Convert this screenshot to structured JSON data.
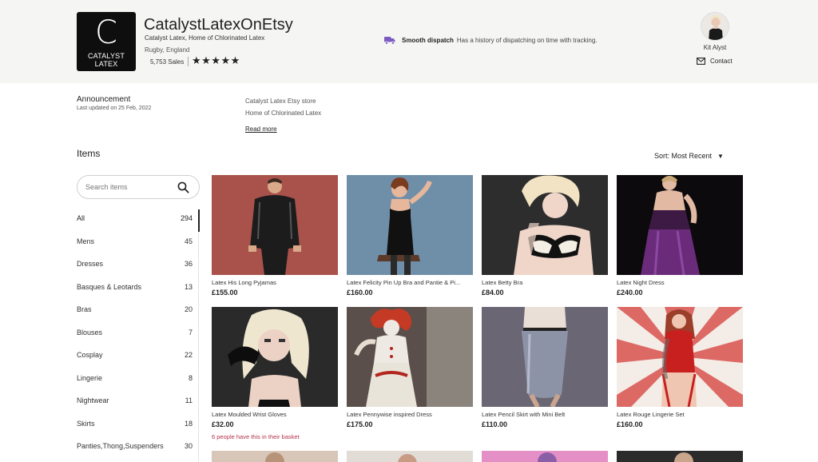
{
  "shop": {
    "logo_letter": "C",
    "logo_text": "CATALYST LATEX",
    "name": "CatalystLatexOnEtsy",
    "tagline": "Catalyst Latex, Home of Chlorinated Latex",
    "location": "Rugby, England",
    "sales": "5,753 Sales",
    "stars": "★★★★★",
    "rating": 5
  },
  "dispatch": {
    "title": "Smooth dispatch",
    "description": "Has a history of dispatching on time with tracking."
  },
  "owner": {
    "name": "Kit Alyst",
    "contact_label": "Contact"
  },
  "announcement": {
    "title": "Announcement",
    "updated": "Last updated on 25 Feb, 2022",
    "line1": "Catalyst Latex Etsy store",
    "line2": "Home of Chlorinated Latex",
    "read_more": "Read more"
  },
  "items": {
    "title": "Items",
    "sort_label": "Sort: Most Recent",
    "search_placeholder": "Search items"
  },
  "sections": [
    {
      "label": "All",
      "count": "294",
      "active": true
    },
    {
      "label": "Mens",
      "count": "45"
    },
    {
      "label": "Dresses",
      "count": "36"
    },
    {
      "label": "Basques & Leotards",
      "count": "13"
    },
    {
      "label": "Bras",
      "count": "20"
    },
    {
      "label": "Blouses",
      "count": "7"
    },
    {
      "label": "Cosplay",
      "count": "22"
    },
    {
      "label": "Lingerie",
      "count": "8"
    },
    {
      "label": "Nightwear",
      "count": "11"
    },
    {
      "label": "Skirts",
      "count": "18"
    },
    {
      "label": "Panties,Thong,Suspenders",
      "count": "30"
    }
  ],
  "products": [
    {
      "title": "Latex His Long Pyjamas",
      "price": "£155.00"
    },
    {
      "title": "Latex Felicity Pin Up Bra and Pantie & Pi...",
      "price": "£160.00"
    },
    {
      "title": "Latex Betty Bra",
      "price": "£84.00"
    },
    {
      "title": "Latex Night Dress",
      "price": "£240.00"
    },
    {
      "title": "Latex Moulded Wrist Gloves",
      "price": "£32.00",
      "basket": "6 people have this in their basket"
    },
    {
      "title": "Latex Pennywise inspired Dress",
      "price": "£175.00"
    },
    {
      "title": "Latex Pencil Skirt with Mini Belt",
      "price": "£110.00"
    },
    {
      "title": "Latex Rouge Lingerie Set",
      "price": "£160.00"
    }
  ],
  "colors": {
    "header_bg": "#f5f5f4",
    "accent_purple": "#7b5bbf",
    "basket_red": "#b3324b"
  },
  "icons": [
    "truck-icon",
    "mail-icon",
    "search-icon",
    "star-icon",
    "caret-down-icon"
  ]
}
